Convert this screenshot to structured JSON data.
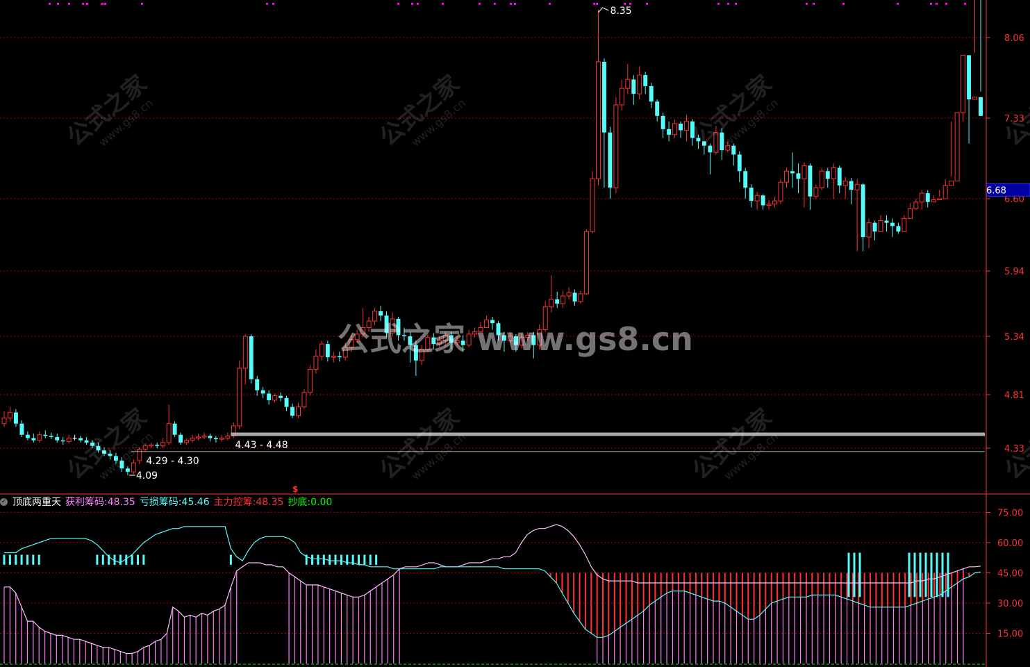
{
  "colors": {
    "up": "#ff3232",
    "down": "#54fcfc",
    "flat": "#ffffff",
    "grid": "#b40000",
    "axis": "#ff3232",
    "profit": "#ff80ff",
    "loss": "#54fcfc",
    "main": "#ff3232",
    "bottom": "#00ff00",
    "signal": "#ff00ff"
  },
  "watermark": {
    "cn": "公式之家",
    "url": "www.gs8.cn",
    "center": "公式之家 www.gs8.cn"
  },
  "price_panel": {
    "y_ticks": [
      "8.06",
      "7.33",
      "6.60",
      "5.94",
      "5.34",
      "4.81",
      "4.33"
    ],
    "current_price": "6.68",
    "labels": {
      "high": "8.35",
      "low": "4.09",
      "zone1": "4.29 - 4.30",
      "zone2": "4.43 - 4.48",
      "signal_mark": "$"
    }
  },
  "indicator_panel": {
    "name": "顶底两重天",
    "values": [
      {
        "label": "获利筹码:",
        "value": "48.35",
        "color": "#ff80ff"
      },
      {
        "label": "亏损筹码:",
        "value": "45.46",
        "color": "#54fcfc"
      },
      {
        "label": "主力控筹:",
        "value": "48.35",
        "color": "#ff3232"
      },
      {
        "label": "抄底:",
        "value": "0.00",
        "color": "#00ff00"
      }
    ],
    "y_ticks": [
      "75.00",
      "60.00",
      "45.00",
      "30.00",
      "15.00"
    ]
  },
  "chart_data": [
    {
      "type": "candlestick",
      "y_ticks": [
        8.06,
        7.33,
        6.6,
        5.94,
        5.34,
        4.81,
        4.33
      ],
      "ylim": [
        4.05,
        8.4
      ],
      "annotations": [
        {
          "text": "8.35",
          "value": 8.35
        },
        {
          "text": "4.09",
          "value": 4.09
        },
        {
          "text": "4.29 - 4.30",
          "value": 4.3
        },
        {
          "text": "4.43 - 4.48",
          "value": 4.45
        }
      ],
      "current_price": 6.68,
      "close": [
        4.6,
        4.65,
        4.55,
        4.45,
        4.42,
        4.4,
        4.45,
        4.44,
        4.43,
        4.4,
        4.39,
        4.42,
        4.42,
        4.4,
        4.38,
        4.35,
        4.31,
        4.28,
        4.26,
        4.22,
        4.15,
        4.12,
        4.2,
        4.32,
        4.35,
        4.36,
        4.35,
        4.38,
        4.55,
        4.45,
        4.38,
        4.4,
        4.42,
        4.43,
        4.44,
        4.42,
        4.41,
        4.42,
        4.44,
        4.53,
        5.05,
        5.34,
        4.95,
        4.85,
        4.82,
        4.76,
        4.8,
        4.78,
        4.7,
        4.62,
        4.7,
        4.83,
        5.04,
        5.16,
        5.27,
        5.15,
        5.16,
        5.15,
        5.24,
        5.31,
        5.36,
        5.42,
        5.48,
        5.57,
        5.53,
        5.37,
        5.5,
        5.35,
        5.34,
        5.26,
        5.12,
        5.22,
        5.33,
        5.27,
        5.3,
        5.35,
        5.28,
        5.3,
        5.26,
        5.36,
        5.38,
        5.42,
        5.49,
        5.46,
        5.35,
        5.3,
        5.34,
        5.26,
        5.33,
        5.35,
        5.26,
        5.4,
        5.61,
        5.68,
        5.64,
        5.71,
        5.74,
        5.66,
        5.73,
        6.3,
        6.78,
        7.84,
        7.2,
        6.7,
        7.45,
        7.6,
        7.68,
        7.55,
        7.72,
        7.62,
        7.48,
        7.35,
        7.23,
        7.18,
        7.28,
        7.22,
        7.3,
        7.15,
        7.12,
        7.08,
        7.02,
        7.2,
        7.04,
        7.08,
        7.0,
        6.85,
        6.7,
        6.58,
        6.63,
        6.54,
        6.55,
        6.58,
        6.75,
        6.85,
        6.83,
        6.78,
        6.9,
        6.62,
        6.7,
        6.85,
        6.78,
        6.88,
        6.72,
        6.76,
        6.68,
        6.73,
        6.25,
        6.38,
        6.3,
        6.4,
        6.38,
        6.35,
        6.3,
        6.42,
        6.51,
        6.57,
        6.65,
        6.57,
        6.59,
        6.6,
        6.72,
        6.76,
        7.38,
        7.9,
        7.5,
        7.52,
        7.35
      ],
      "open": [
        4.55,
        4.6,
        4.65,
        4.55,
        4.45,
        4.42,
        4.4,
        4.45,
        4.44,
        4.43,
        4.4,
        4.39,
        4.42,
        4.42,
        4.4,
        4.38,
        4.35,
        4.31,
        4.28,
        4.26,
        4.22,
        4.15,
        4.12,
        4.22,
        4.32,
        4.35,
        4.36,
        4.35,
        4.38,
        4.55,
        4.45,
        4.38,
        4.4,
        4.42,
        4.43,
        4.44,
        4.42,
        4.41,
        4.42,
        4.44,
        4.53,
        5.05,
        5.34,
        4.95,
        4.85,
        4.82,
        4.76,
        4.8,
        4.78,
        4.7,
        4.62,
        4.7,
        4.83,
        5.04,
        5.16,
        5.27,
        5.15,
        5.16,
        5.15,
        5.24,
        5.31,
        5.36,
        5.42,
        5.48,
        5.57,
        5.53,
        5.37,
        5.5,
        5.35,
        5.34,
        5.26,
        5.12,
        5.22,
        5.33,
        5.27,
        5.3,
        5.35,
        5.28,
        5.3,
        5.26,
        5.36,
        5.38,
        5.42,
        5.49,
        5.46,
        5.35,
        5.3,
        5.34,
        5.26,
        5.33,
        5.35,
        5.26,
        5.4,
        5.61,
        5.68,
        5.64,
        5.71,
        5.74,
        5.66,
        5.73,
        6.3,
        6.78,
        7.84,
        7.2,
        6.7,
        7.45,
        7.6,
        7.68,
        7.55,
        7.72,
        7.62,
        7.48,
        7.35,
        7.23,
        7.18,
        7.28,
        7.22,
        7.3,
        7.15,
        7.12,
        7.08,
        7.02,
        7.2,
        7.04,
        7.08,
        7.0,
        6.85,
        6.7,
        6.58,
        6.63,
        6.54,
        6.55,
        6.58,
        6.75,
        6.85,
        6.83,
        6.78,
        6.9,
        6.62,
        6.7,
        6.85,
        6.78,
        6.88,
        6.72,
        6.76,
        6.68,
        6.73,
        6.25,
        6.38,
        6.3,
        6.4,
        6.38,
        6.35,
        6.3,
        6.42,
        6.51,
        6.57,
        6.65,
        6.57,
        6.59,
        6.6,
        6.72,
        6.76,
        7.38,
        7.9,
        7.5,
        7.52
      ],
      "high": [
        4.66,
        4.7,
        4.68,
        4.58,
        4.48,
        4.46,
        4.48,
        4.49,
        4.47,
        4.46,
        4.43,
        4.45,
        4.45,
        4.44,
        4.43,
        4.4,
        4.38,
        4.34,
        4.31,
        4.29,
        4.25,
        4.17,
        4.23,
        4.34,
        4.37,
        4.38,
        4.38,
        4.42,
        4.72,
        4.57,
        4.47,
        4.42,
        4.45,
        4.46,
        4.47,
        4.46,
        4.44,
        4.45,
        4.47,
        4.56,
        5.12,
        5.36,
        5.36,
        4.98,
        4.88,
        4.85,
        4.82,
        4.83,
        4.8,
        4.73,
        4.74,
        4.86,
        5.08,
        5.22,
        5.3,
        5.3,
        5.2,
        5.2,
        5.28,
        5.35,
        5.4,
        5.6,
        5.52,
        5.6,
        5.62,
        5.57,
        5.56,
        5.52,
        5.42,
        5.38,
        5.3,
        5.26,
        5.36,
        5.37,
        5.34,
        5.38,
        5.38,
        5.34,
        5.35,
        5.4,
        5.42,
        5.47,
        5.53,
        5.52,
        5.48,
        5.38,
        5.38,
        5.36,
        5.37,
        5.38,
        5.38,
        5.45,
        5.66,
        5.9,
        5.75,
        5.76,
        5.79,
        5.77,
        5.76,
        6.32,
        6.85,
        8.35,
        7.87,
        7.25,
        7.52,
        7.68,
        7.82,
        7.72,
        7.8,
        7.75,
        7.65,
        7.5,
        7.38,
        7.3,
        7.32,
        7.3,
        7.36,
        7.32,
        7.18,
        7.12,
        7.1,
        7.26,
        7.24,
        7.12,
        7.1,
        7.03,
        6.88,
        6.73,
        6.66,
        6.64,
        6.59,
        6.62,
        6.78,
        6.88,
        7.02,
        6.92,
        6.93,
        6.92,
        6.73,
        6.88,
        6.88,
        6.92,
        6.9,
        6.8,
        6.79,
        6.78,
        6.74,
        6.42,
        6.4,
        6.45,
        6.45,
        6.42,
        6.38,
        6.45,
        6.56,
        6.6,
        6.68,
        6.68,
        6.63,
        6.62,
        6.78,
        6.8,
        7.0,
        7.42,
        7.9,
        7.92,
        7.57,
        7.55
      ],
      "low": [
        4.52,
        4.57,
        4.52,
        4.43,
        4.4,
        4.38,
        4.38,
        4.42,
        4.41,
        4.38,
        4.36,
        4.37,
        4.4,
        4.38,
        4.36,
        4.33,
        4.29,
        4.26,
        4.23,
        4.19,
        4.12,
        4.09,
        4.1,
        4.19,
        4.3,
        4.33,
        4.33,
        4.33,
        4.36,
        4.43,
        4.36,
        4.36,
        4.38,
        4.4,
        4.41,
        4.39,
        4.38,
        4.39,
        4.4,
        4.42,
        4.5,
        4.9,
        4.91,
        4.8,
        4.78,
        4.72,
        4.74,
        4.75,
        4.66,
        4.6,
        4.6,
        4.68,
        4.8,
        5.0,
        5.12,
        5.11,
        5.1,
        5.11,
        5.12,
        5.2,
        5.28,
        5.33,
        5.38,
        5.44,
        5.48,
        5.33,
        5.34,
        5.3,
        5.3,
        5.1,
        4.98,
        5.08,
        5.2,
        5.22,
        5.24,
        5.25,
        5.22,
        5.26,
        5.21,
        5.24,
        5.33,
        5.38,
        5.42,
        5.4,
        5.3,
        5.2,
        5.28,
        5.2,
        5.23,
        5.3,
        5.14,
        5.22,
        5.38,
        5.56,
        5.6,
        5.6,
        5.68,
        5.62,
        5.64,
        5.72,
        6.28,
        6.72,
        6.7,
        6.6,
        6.65,
        7.4,
        7.55,
        7.45,
        7.5,
        7.55,
        7.42,
        7.3,
        7.15,
        7.12,
        7.15,
        7.15,
        7.12,
        7.08,
        7.05,
        7.0,
        6.82,
        7.0,
        6.95,
        7.02,
        6.9,
        6.75,
        6.6,
        6.52,
        6.5,
        6.5,
        6.5,
        6.52,
        6.55,
        6.7,
        6.7,
        6.65,
        6.52,
        6.5,
        6.6,
        6.68,
        6.7,
        6.6,
        6.65,
        6.6,
        6.55,
        6.12,
        6.12,
        6.15,
        6.22,
        6.32,
        6.3,
        6.25,
        6.28,
        6.4,
        6.45,
        6.5,
        6.5,
        6.52,
        6.58,
        6.68,
        6.72,
        7.3,
        7.35,
        7.3,
        7.1
      ]
    },
    {
      "type": "area",
      "name": "顶底两重天",
      "y_ticks": [
        75,
        60,
        45,
        30,
        15
      ],
      "ylim": [
        0,
        80
      ],
      "series": [
        {
          "name": "获利筹码",
          "values": [
            38,
            38,
            35,
            28,
            21,
            21,
            18,
            16,
            15,
            14,
            14,
            13,
            12,
            12,
            11,
            10,
            9,
            8,
            8,
            7,
            6,
            5,
            5,
            6,
            8,
            9,
            11,
            12,
            15,
            28,
            26,
            23,
            24,
            23,
            25,
            24,
            26,
            27,
            29,
            38,
            46,
            48,
            50,
            50,
            50,
            49,
            49,
            48,
            48,
            45,
            43,
            41,
            39,
            39,
            39,
            38,
            37,
            36,
            35,
            34,
            33,
            33,
            34,
            36,
            38,
            40,
            42,
            44,
            47,
            48,
            48,
            48,
            49,
            50,
            50,
            49,
            48,
            48,
            48,
            49,
            50,
            50,
            50,
            51,
            52,
            52,
            53,
            53,
            55,
            60,
            64,
            66,
            67,
            67,
            68,
            69,
            68,
            66,
            63,
            59,
            54,
            48,
            44,
            42,
            41,
            41,
            41,
            41,
            41,
            40,
            40,
            40,
            40,
            40,
            40,
            40,
            40,
            40,
            40,
            40,
            40,
            40,
            40,
            40,
            40,
            40,
            40,
            40,
            40,
            40,
            40,
            40,
            40,
            40,
            40,
            40,
            40,
            40,
            40,
            40,
            40,
            40,
            40,
            40,
            40,
            40,
            40,
            40,
            40,
            40,
            40,
            40,
            40,
            40,
            40,
            40,
            40,
            41,
            41,
            42,
            42,
            43,
            44,
            45,
            46,
            47,
            48,
            48,
            48.35
          ]
        },
        {
          "name": "亏损筹码",
          "values": [
            55,
            55,
            55,
            57,
            58,
            59,
            60,
            61,
            62,
            62,
            62,
            62,
            62,
            62,
            62,
            61,
            59,
            56,
            53,
            51,
            50,
            52,
            54,
            57,
            60,
            62,
            64,
            65,
            66,
            67,
            67,
            68,
            68,
            68,
            68,
            68,
            68,
            68,
            68,
            57,
            53,
            51,
            56,
            60,
            62,
            63,
            63,
            63,
            63,
            62,
            60,
            55,
            53,
            52,
            52,
            52,
            51,
            51,
            51,
            50,
            50,
            49,
            49,
            48,
            48,
            48,
            48,
            47,
            47,
            47,
            47,
            47,
            47,
            47,
            47,
            48,
            48,
            48,
            48,
            48,
            48,
            48,
            48,
            48,
            48,
            48,
            47,
            47,
            47,
            47,
            47,
            47,
            47,
            46,
            43,
            40,
            35,
            30,
            25,
            21,
            17,
            15,
            13,
            13,
            14,
            16,
            18,
            20,
            22,
            24,
            26,
            29,
            31,
            33,
            35,
            36,
            36,
            36,
            35,
            34,
            33,
            32,
            31,
            31,
            30,
            28,
            26,
            24,
            22,
            22,
            24,
            27,
            30,
            31,
            32,
            33,
            33,
            33,
            33,
            34,
            34,
            34,
            34,
            34,
            33,
            32,
            31,
            30,
            29,
            28,
            28,
            28,
            28,
            28,
            28,
            28,
            29,
            30,
            31,
            32,
            33,
            34,
            36,
            38,
            40,
            42,
            43,
            45,
            45.46
          ]
        },
        {
          "name": "主力控筹",
          "values": [
            48,
            48,
            48,
            48,
            48,
            48,
            48,
            48,
            48,
            48,
            48,
            48,
            48,
            48,
            48,
            48,
            48,
            48,
            48,
            48,
            48,
            48,
            48,
            48,
            48,
            48,
            48,
            48,
            48,
            48,
            48,
            48,
            48,
            48,
            48,
            48,
            48,
            48,
            48,
            48,
            48,
            48,
            48,
            48,
            48,
            48,
            48,
            48,
            48,
            48,
            48,
            48,
            48,
            48,
            48,
            48,
            48,
            48,
            48,
            48,
            48,
            48,
            48,
            48,
            48,
            48,
            48,
            48,
            48,
            48,
            48,
            48,
            48,
            48,
            48,
            48,
            48,
            48,
            48,
            48,
            48,
            48,
            48,
            48,
            48,
            48,
            48,
            48,
            48,
            48,
            48,
            48,
            48,
            48,
            48,
            48,
            48,
            48,
            48,
            48,
            48,
            48,
            48,
            48,
            48,
            48,
            48,
            48,
            48,
            48,
            48,
            48,
            48,
            48,
            48,
            48,
            48,
            48,
            48,
            48,
            48,
            48,
            48,
            48,
            48,
            48,
            48,
            48,
            48,
            48,
            48,
            48,
            48,
            48,
            48,
            48,
            48,
            48,
            48,
            48,
            48,
            48,
            48,
            48,
            48,
            48,
            48,
            48,
            48,
            48,
            48,
            48,
            48,
            48,
            48,
            48,
            48,
            48,
            48,
            48,
            48,
            48,
            48,
            48,
            48,
            48,
            48,
            48,
            48.35
          ]
        },
        {
          "name": "抄底",
          "values": [
            0,
            0
          ]
        }
      ]
    }
  ]
}
